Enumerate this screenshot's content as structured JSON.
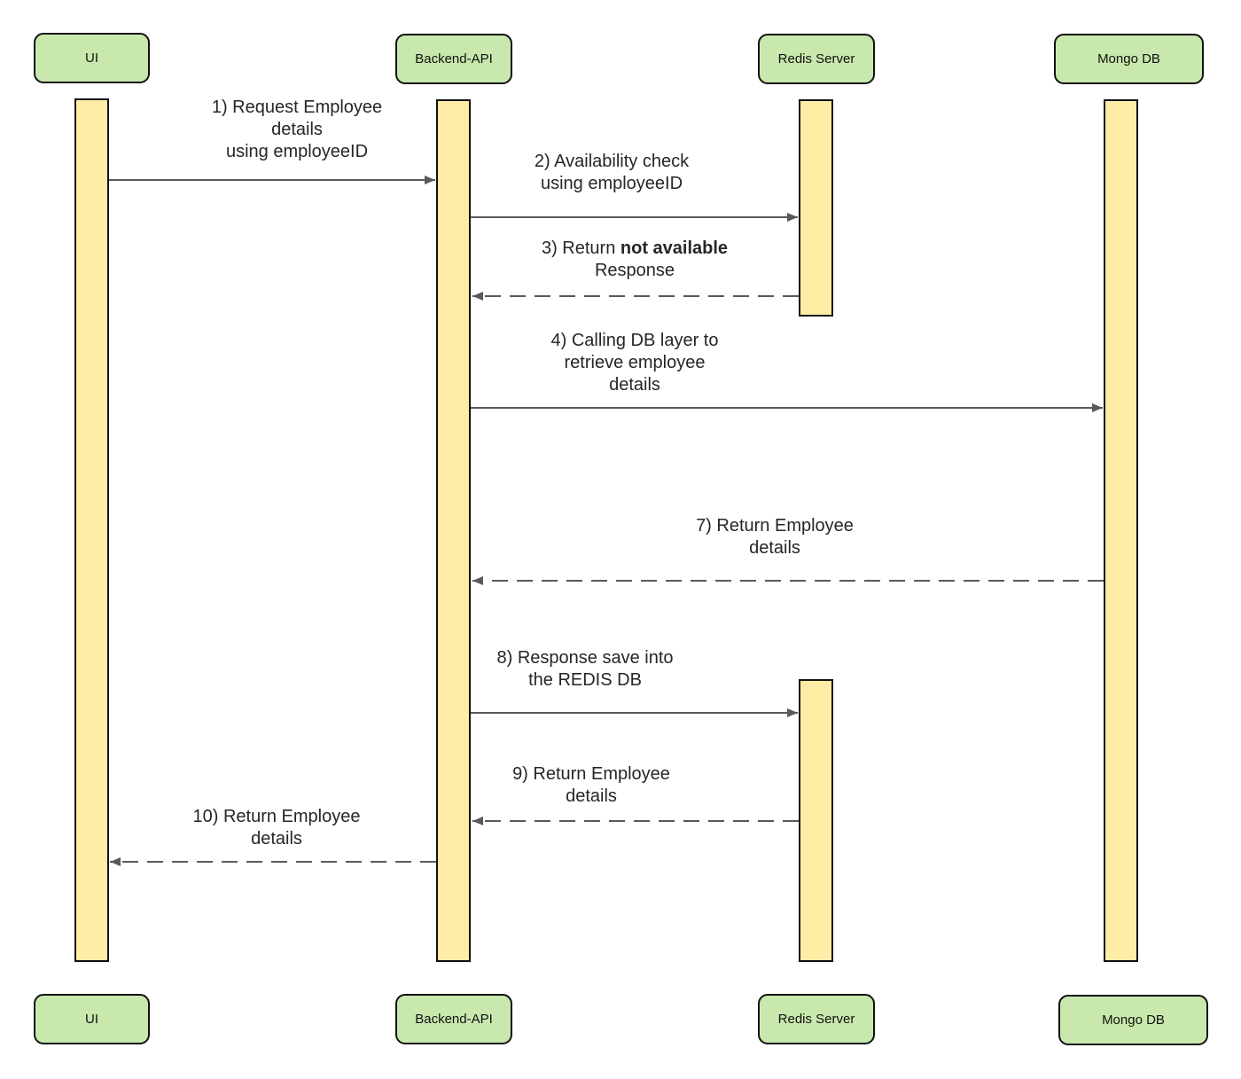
{
  "colors": {
    "actor_fill": "#c8e8ad",
    "activation_fill": "#ffeca6",
    "arrow": "#595959",
    "border": "#111111"
  },
  "actors": [
    {
      "id": "ui",
      "label": "UI"
    },
    {
      "id": "backend",
      "label": "Backend-API"
    },
    {
      "id": "redis",
      "label": "Redis Server"
    },
    {
      "id": "mongo",
      "label": "Mongo DB"
    }
  ],
  "messages": [
    {
      "step": "1",
      "from": "ui",
      "to": "backend",
      "style": "solid",
      "lines": [
        "1) Request  Employee",
        "details",
        "using employeeID"
      ]
    },
    {
      "step": "2",
      "from": "backend",
      "to": "redis",
      "style": "solid",
      "lines": [
        "2) Availability check",
        "using employeeID"
      ]
    },
    {
      "step": "3",
      "from": "redis",
      "to": "backend",
      "style": "dashed",
      "lines": [
        "3) Return ",
        "not available",
        "Response"
      ],
      "bold_segment": "not available"
    },
    {
      "step": "4",
      "from": "backend",
      "to": "mongo",
      "style": "solid",
      "lines": [
        "4) Calling DB layer to",
        "retrieve employee",
        "details"
      ]
    },
    {
      "step": "7",
      "from": "mongo",
      "to": "backend",
      "style": "dashed",
      "lines": [
        "7) Return Employee",
        "details"
      ]
    },
    {
      "step": "8",
      "from": "backend",
      "to": "redis",
      "style": "solid",
      "lines": [
        "8) Response save into",
        "the REDIS DB"
      ]
    },
    {
      "step": "9",
      "from": "redis",
      "to": "backend",
      "style": "dashed",
      "lines": [
        "9) Return Employee",
        "details"
      ]
    },
    {
      "step": "10",
      "from": "backend",
      "to": "ui",
      "style": "dashed",
      "lines": [
        "10) Return Employee",
        "details"
      ]
    }
  ]
}
